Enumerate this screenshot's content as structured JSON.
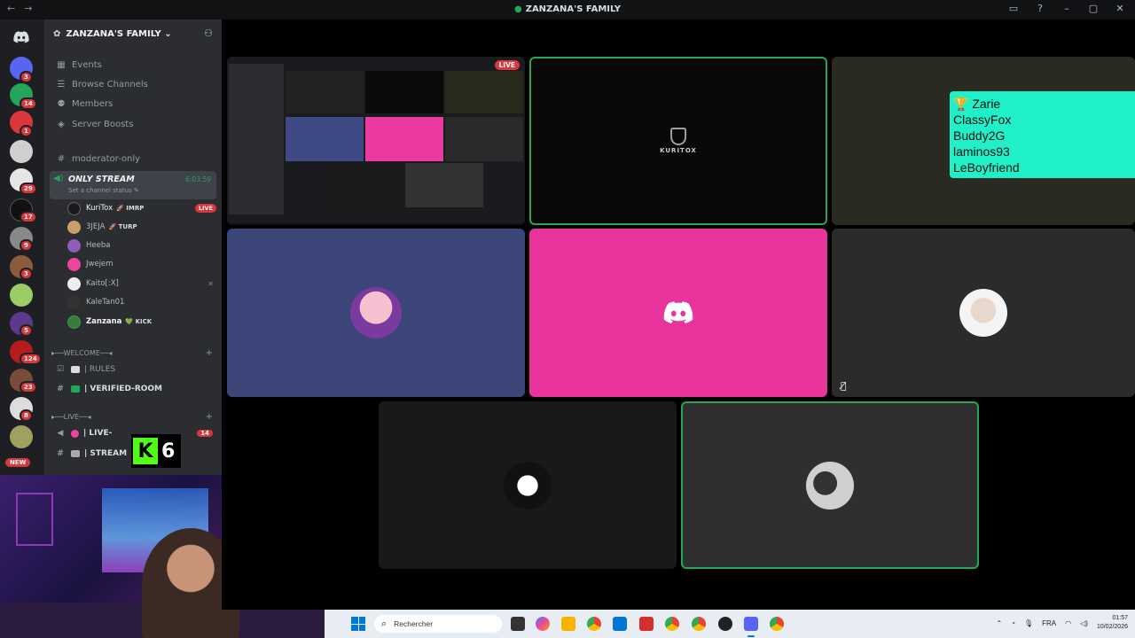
{
  "window": {
    "title": "ZANZANA'S FAMILY",
    "controls": [
      "▭",
      "?",
      "–",
      "▢",
      "✕"
    ]
  },
  "rail": {
    "badges": [
      "3",
      "14",
      "1",
      "29",
      "17",
      "9",
      "3",
      "5",
      "124",
      "23",
      "8"
    ],
    "new_label": "NEW"
  },
  "server": {
    "name": "ZANZANA'S FAMILY ⌄"
  },
  "nav": [
    {
      "label": "Events",
      "icon": "calendar-icon"
    },
    {
      "label": "Browse Channels",
      "icon": "browse-icon"
    },
    {
      "label": "Members",
      "icon": "members-icon"
    },
    {
      "label": "Server Boosts",
      "icon": "boost-icon"
    }
  ],
  "channels": {
    "moderator_only": "moderator-only",
    "voice": {
      "name": "ONLY STREAM",
      "status": "Set a channel status ✎",
      "timer": "6:03:59"
    },
    "members": [
      {
        "name": "KuriTox",
        "tag": "🚀 IMRP",
        "live": "LIVE"
      },
      {
        "name": "3JEJA",
        "tag": "🚀 TURP"
      },
      {
        "name": "Heeba"
      },
      {
        "name": "Jwejem"
      },
      {
        "name": "Kaito[:X]"
      },
      {
        "name": "KaleTan01"
      },
      {
        "name": "Zanzana",
        "tag": "💚 KICK"
      }
    ],
    "cat_welcome": "▸──WELCOME──◂",
    "rules": "| RULES",
    "verified": "| VERIFIED-ROOM",
    "cat_live": "▸──LIVE──◂",
    "live_chan": "| LIVE-",
    "live_count": "14",
    "stream_chan": "| STREAM",
    "kick_count": "6"
  },
  "stage": {
    "live_label": "LIVE",
    "kuritox_logo": "KURITOX",
    "overlay_names": [
      "🏆 Zarie",
      "ClassyFox",
      "Buddy2G",
      "laminos93",
      "LeBoyfriend"
    ]
  },
  "taskbar": {
    "search_placeholder": "Rechercher",
    "lang": "FRA",
    "time": "01:57",
    "date": "10/02/2026"
  }
}
